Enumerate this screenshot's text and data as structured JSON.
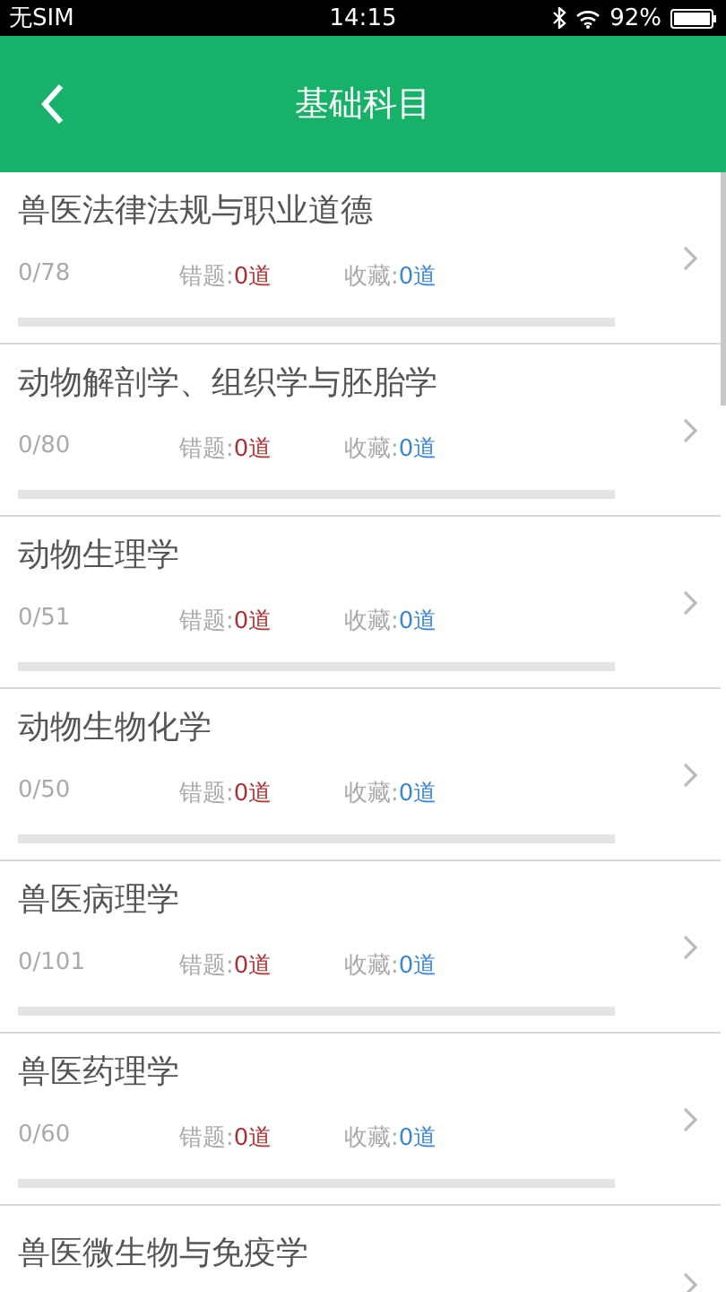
{
  "status_bar": {
    "carrier": "无SIM",
    "time": "14:15",
    "battery": "92%"
  },
  "header": {
    "title": "基础科目"
  },
  "subjects": [
    {
      "kind": "full",
      "title": "兽医法律法规与职业道德",
      "progress": "0/78",
      "wrong_label": "错题:",
      "wrong": "0道",
      "fav_label": "收藏:",
      "fav": "0道",
      "level": 0
    },
    {
      "kind": "full",
      "title": "动物解剖学、组织学与胚胎学",
      "progress": "0/80",
      "wrong_label": "错题:",
      "wrong": "0道",
      "fav_label": "收藏:",
      "fav": "0道",
      "level": 0
    },
    {
      "kind": "full",
      "title": "动物生理学",
      "progress": "0/51",
      "wrong_label": "错题:",
      "wrong": "0道",
      "fav_label": "收藏:",
      "fav": "0道",
      "level": 0
    },
    {
      "kind": "full",
      "title": "动物生物化学",
      "progress": "0/50",
      "wrong_label": "错题:",
      "wrong": "0道",
      "fav_label": "收藏:",
      "fav": "0道",
      "level": 0
    },
    {
      "kind": "full",
      "title": "兽医病理学",
      "progress": "0/101",
      "wrong_label": "错题:",
      "wrong": "0道",
      "fav_label": "收藏:",
      "fav": "0道",
      "level": 0
    },
    {
      "kind": "full",
      "title": "兽医药理学",
      "progress": "0/60",
      "wrong_label": "错题:",
      "wrong": "0道",
      "fav_label": "收藏:",
      "fav": "0道",
      "level": 0
    },
    {
      "kind": "partial",
      "title": "兽医微生物与免疫学"
    }
  ]
}
